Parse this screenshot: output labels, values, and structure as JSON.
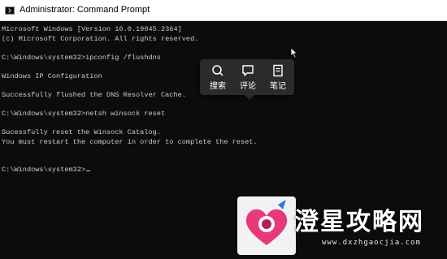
{
  "window": {
    "title": "Administrator: Command Prompt"
  },
  "console": {
    "lines": [
      "Microsoft Windows [Version 10.0.19045.2364]",
      "(c) Microsoft Corporation. All rights reserved.",
      "C:\\Windows\\system32>ipconfig /flushdns",
      "Windows IP Configuration",
      "Successfully flushed the DNS Resolver Cache.",
      "C:\\Windows\\system32>netsh winsock reset",
      "Sucessfully reset the Winsock Catalog.",
      "You must restart the computer in order to complete the reset.",
      "C:\\Windows\\system32>"
    ]
  },
  "popup": {
    "items": [
      {
        "label": "搜索",
        "icon": "search-icon"
      },
      {
        "label": "评论",
        "icon": "comment-icon"
      },
      {
        "label": "笔记",
        "icon": "note-icon"
      }
    ]
  },
  "watermark": {
    "brand": "澄星攻略网",
    "url": "www.dxzhgaocjia.com"
  },
  "colors": {
    "console_bg": "#0c0c0c",
    "console_text": "#cccccc",
    "popup_bg": "#2b2b2b",
    "logo_pink": "#e8397a"
  }
}
